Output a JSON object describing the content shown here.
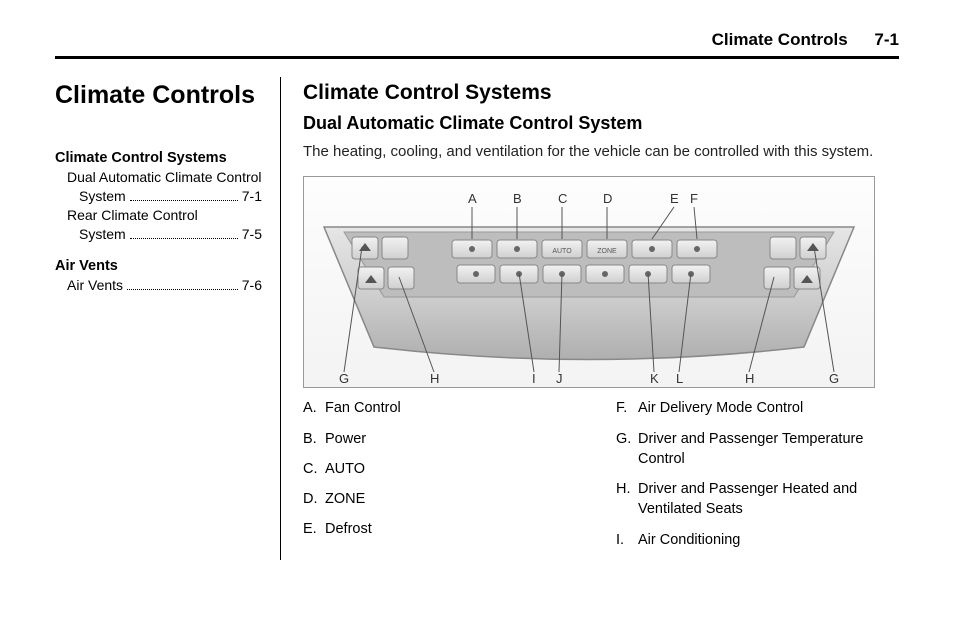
{
  "header": {
    "section": "Climate Controls",
    "page": "7-1"
  },
  "left": {
    "chapter_title": "Climate Controls",
    "toc": [
      {
        "group_title": "Climate Control Systems",
        "items": [
          {
            "label_line1": "Dual Automatic Climate Control",
            "label_line2": "System",
            "page": "7-1"
          },
          {
            "label_line1": "Rear Climate Control",
            "label_line2": "System",
            "page": "7-5"
          }
        ]
      },
      {
        "group_title": "Air Vents",
        "items": [
          {
            "label_line1": "Air Vents",
            "label_line2": "",
            "page": "7-6"
          }
        ]
      }
    ]
  },
  "right": {
    "section_heading": "Climate Control Systems",
    "sub_heading": "Dual Automatic Climate Control System",
    "intro": "The heating, cooling, and ventilation for the vehicle can be controlled with this system.",
    "diagram_labels": [
      "A",
      "B",
      "C",
      "D",
      "E",
      "F",
      "G",
      "H",
      "I",
      "J",
      "K",
      "L",
      "H",
      "G"
    ],
    "legend_left": [
      {
        "letter": "A.",
        "text": "Fan Control"
      },
      {
        "letter": "B.",
        "text": "Power"
      },
      {
        "letter": "C.",
        "text": "AUTO"
      },
      {
        "letter": "D.",
        "text": "ZONE"
      },
      {
        "letter": "E.",
        "text": "Defrost"
      }
    ],
    "legend_right": [
      {
        "letter": "F.",
        "text": "Air Delivery Mode Control"
      },
      {
        "letter": "G.",
        "text": "Driver and Passenger Temperature Control"
      },
      {
        "letter": "H.",
        "text": "Driver and Passenger Heated and Ventilated Seats"
      },
      {
        "letter": "I.",
        "text": "Air Conditioning"
      }
    ]
  }
}
